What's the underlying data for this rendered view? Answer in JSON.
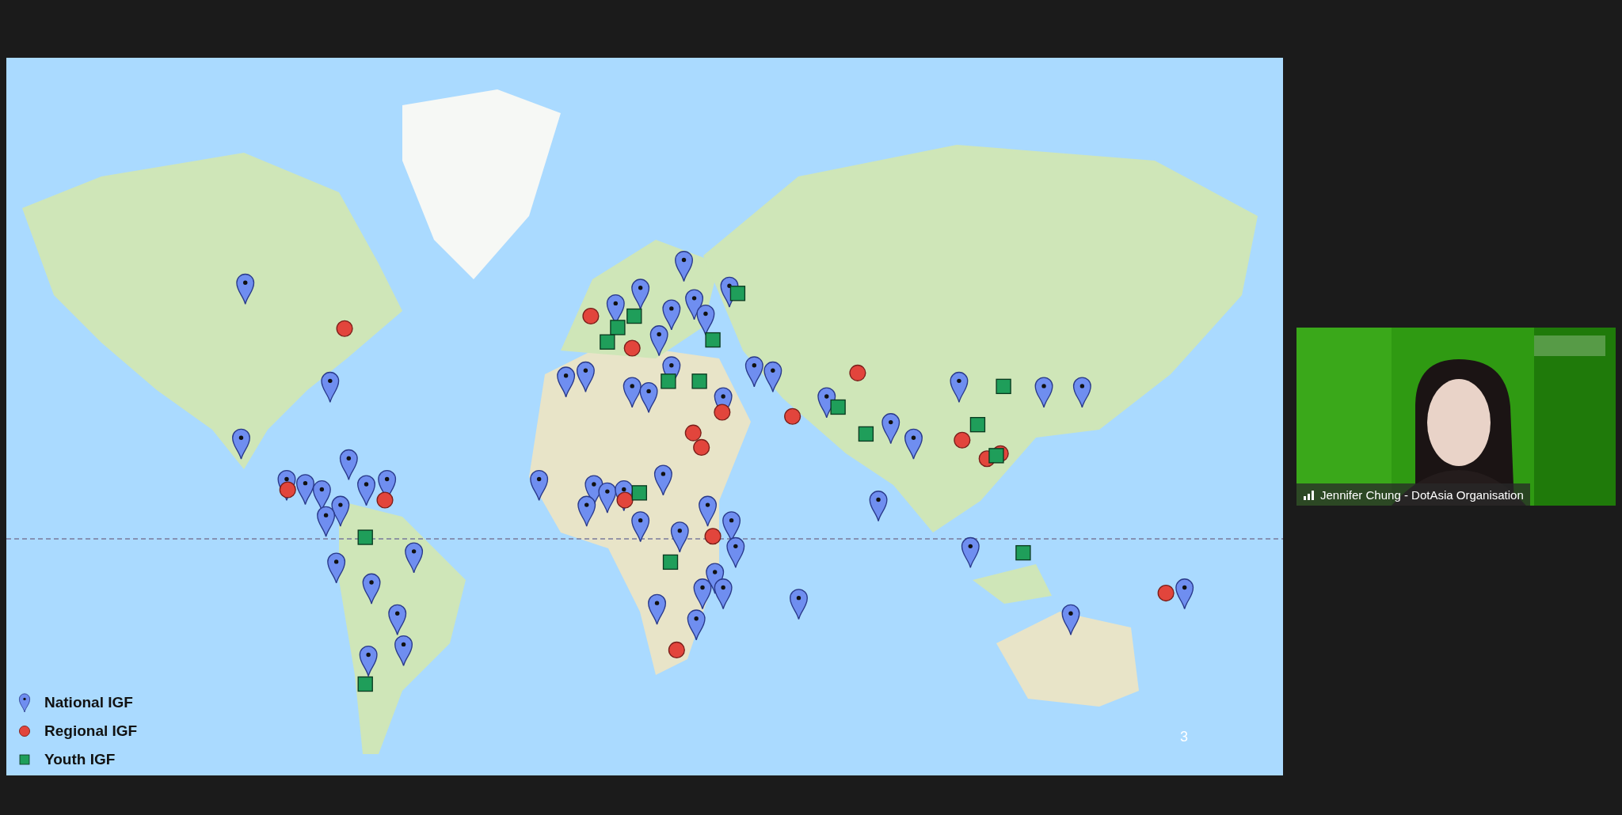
{
  "slide": {
    "legend": [
      {
        "kind": "national",
        "label": "National IGF"
      },
      {
        "kind": "regional",
        "label": "Regional IGF"
      },
      {
        "kind": "youth",
        "label": "Youth IGF"
      }
    ],
    "page_number": "3"
  },
  "video_tile": {
    "participant_name": "Jennifer Chung - DotAsia Organisation"
  }
}
